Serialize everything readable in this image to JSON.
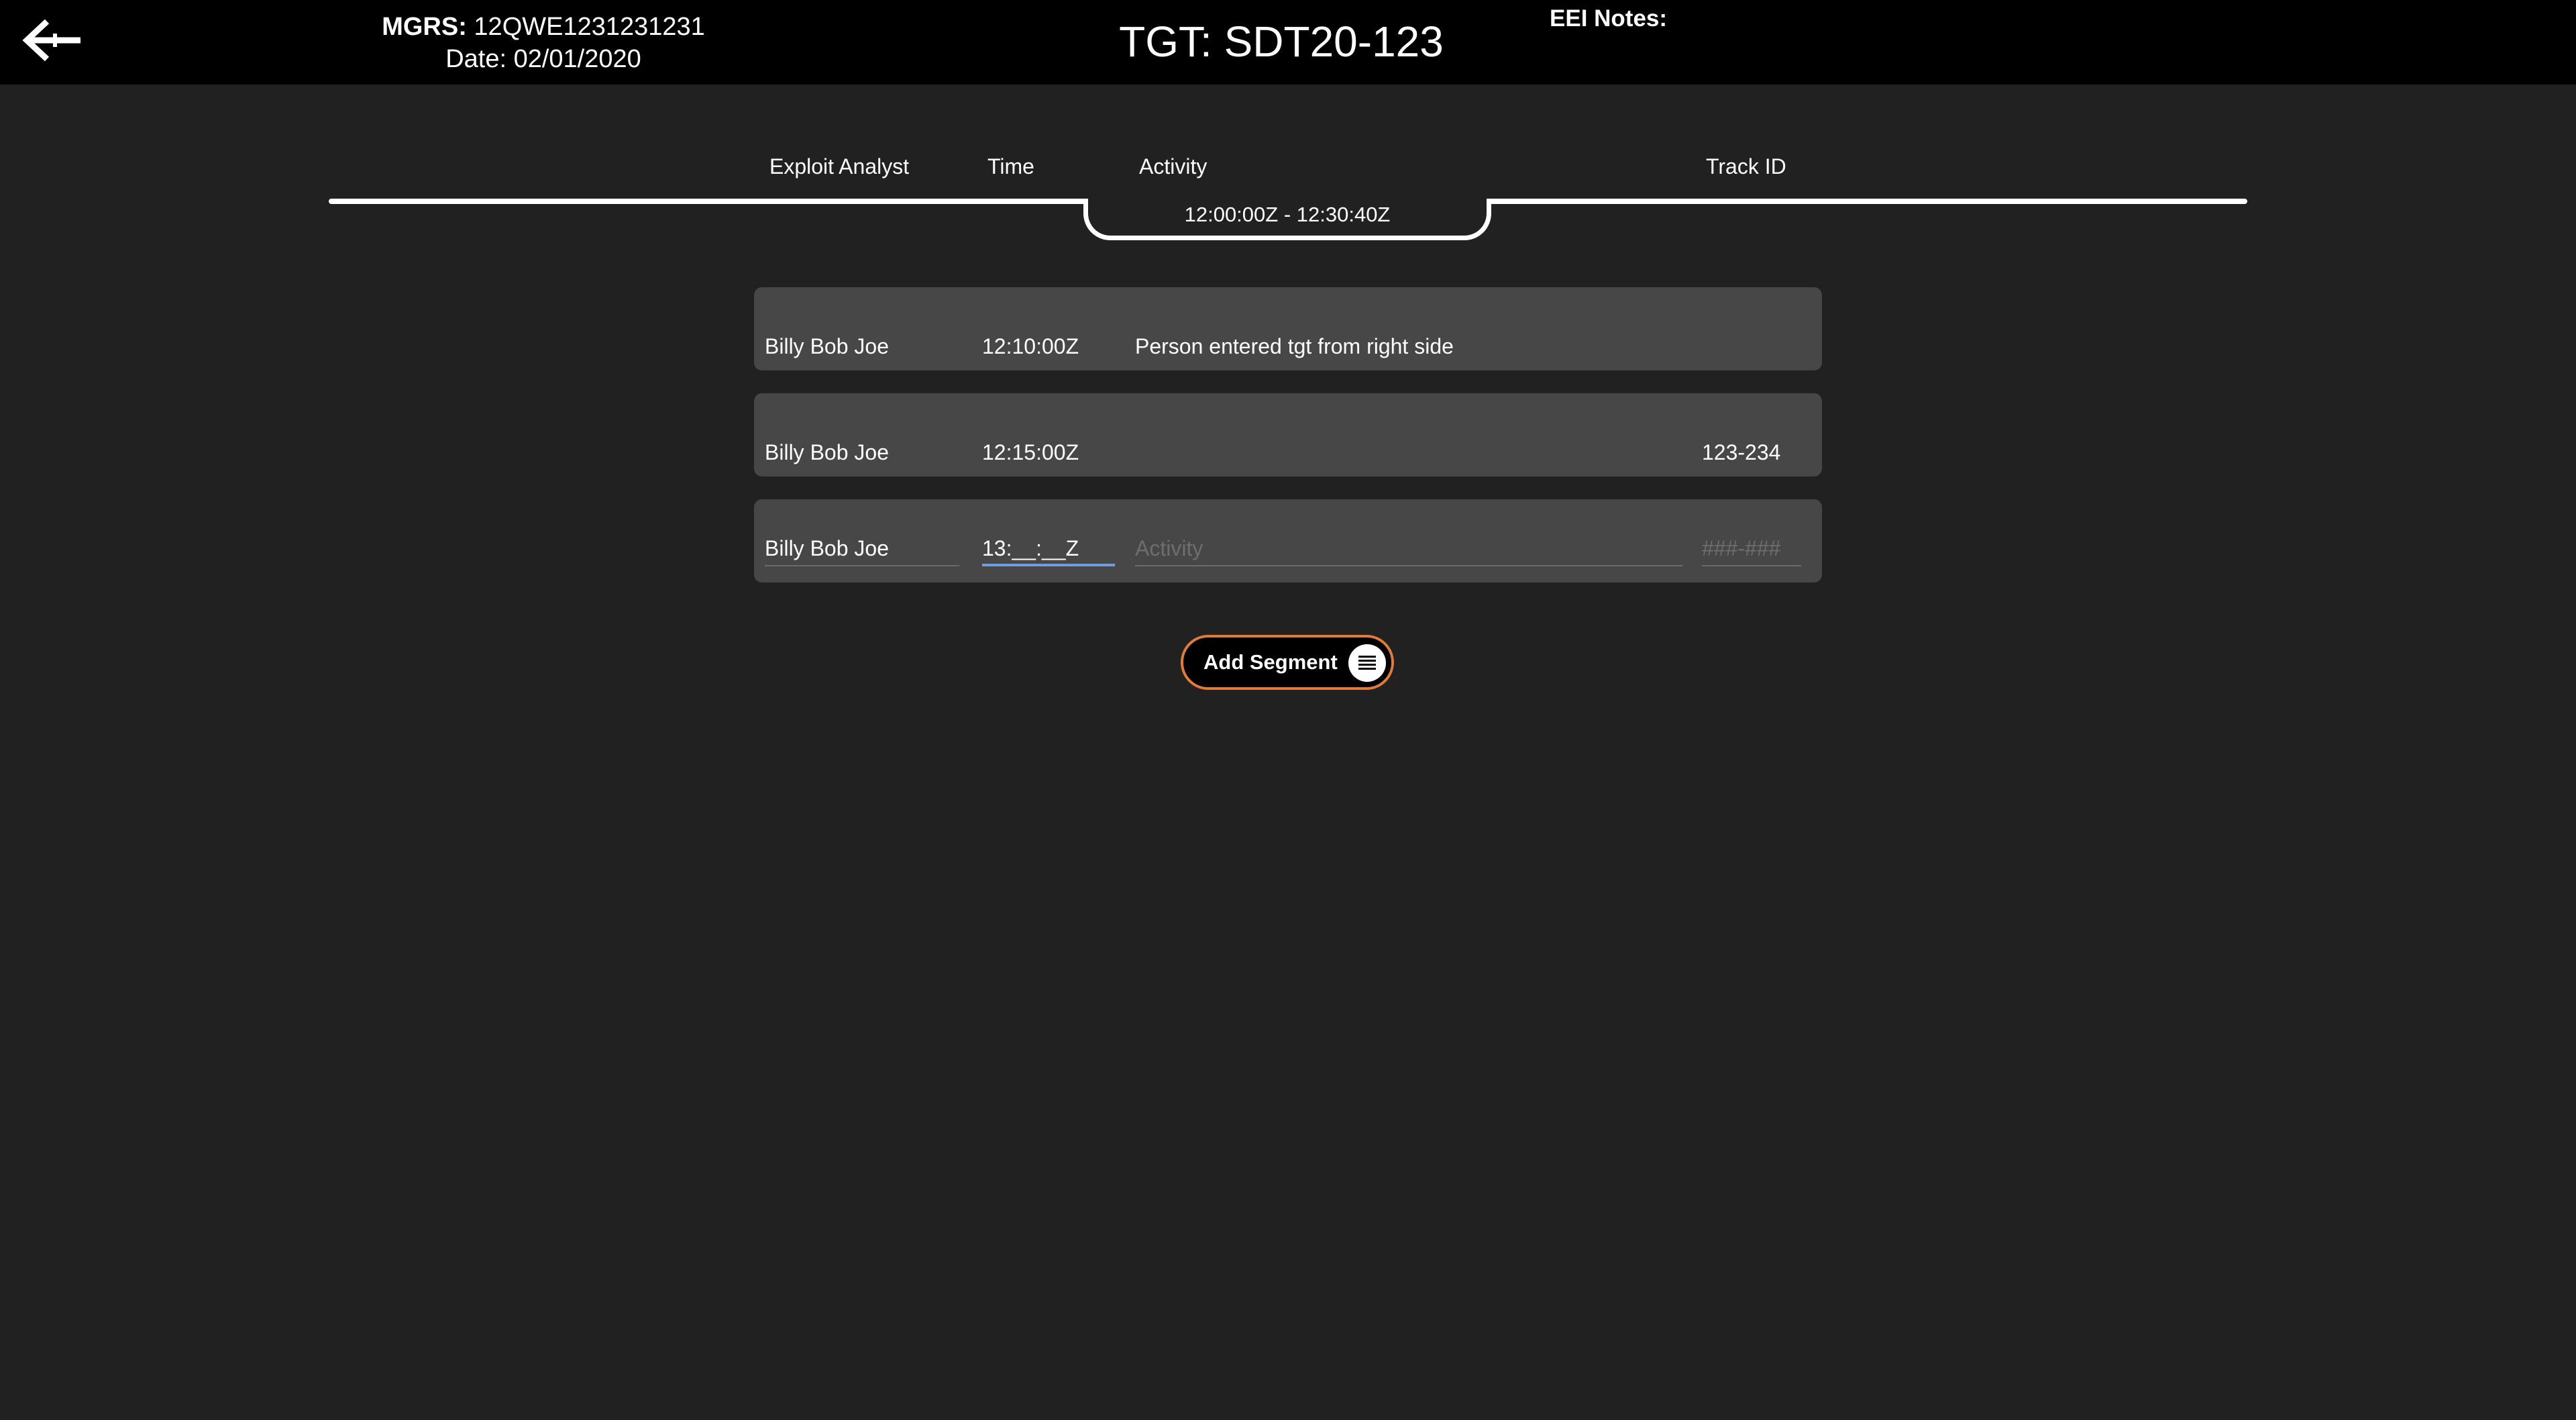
{
  "header": {
    "mgrs_label": "MGRS:",
    "mgrs_value": "12QWE1231231231",
    "date": "Date: 02/01/2020",
    "target": "TGT: SDT20-123",
    "eei_notes": "EEI Notes:"
  },
  "columns": {
    "analyst": "Exploit Analyst",
    "time": "Time",
    "activity": "Activity",
    "track_id": "Track ID"
  },
  "timeline": {
    "range": "12:00:00Z - 12:30:40Z"
  },
  "segments": [
    {
      "analyst": "Billy Bob Joe",
      "time": "12:10:00Z",
      "activity": "Person entered tgt from right side",
      "track_id": ""
    },
    {
      "analyst": "Billy Bob Joe",
      "time": "12:15:00Z",
      "activity": "",
      "track_id": "123-234"
    }
  ],
  "new_segment": {
    "analyst": "Billy Bob Joe",
    "time": "13:__:__Z",
    "activity_placeholder": "Activity",
    "track_placeholder": "###-###"
  },
  "actions": {
    "add_segment": "Add Segment"
  },
  "icons": {
    "back": "arrow-left-icon",
    "add_segment": "list-icon"
  },
  "colors": {
    "accent": "#e07b39",
    "focus": "#6f9fd8"
  }
}
